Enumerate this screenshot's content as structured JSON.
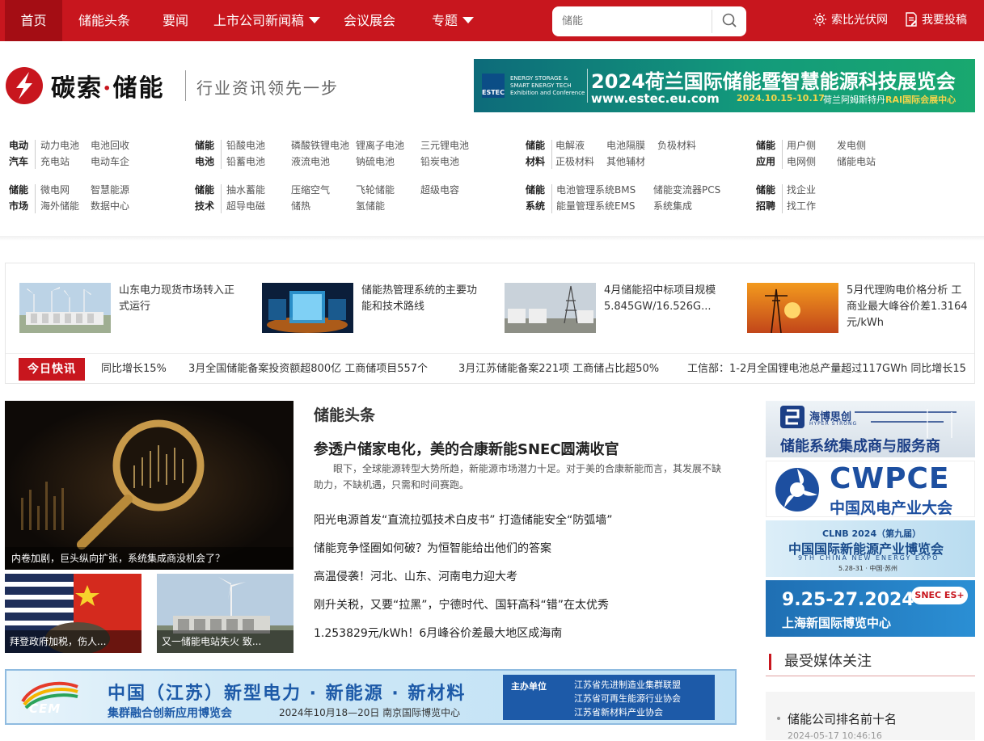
{
  "nav": {
    "home": "首页",
    "items": [
      "储能头条",
      "要闻",
      "上市公司新闻稿",
      "会议展会",
      "专题"
    ],
    "search_placeholder": "储能",
    "link1": "索比光伏网",
    "link2": "我要投稿"
  },
  "brand": {
    "name_part1": "碳索",
    "dot": "·",
    "name_part2": "储能",
    "slogan": "行业资讯领先一步"
  },
  "estec_banner": {
    "logo": "ESTEC",
    "sub": "ENERGY STORAGE & SMART ENERGY TECH",
    "sub2": "Exhibition and Conference",
    "title": "2024荷兰国际储能暨智慧能源科技展览会",
    "url": "www.estec.eu.com",
    "date": "2024.10.15-10.17",
    "venue": "荷兰阿姆斯特丹",
    "venue_hl": "RAI国际会展中心"
  },
  "categories": [
    {
      "l1": "电动",
      "l2": "汽车",
      "links": [
        "动力电池",
        "电池回收",
        "充电站",
        "电动车企"
      ]
    },
    {
      "l1": "储能",
      "l2": "电池",
      "links": [
        "铅酸电池",
        "磷酸铁锂电池",
        "锂离子电池",
        "三元锂电池",
        "铅蓄电池",
        "液流电池",
        "钠硫电池",
        "铅炭电池"
      ]
    },
    {
      "l1": "储能",
      "l2": "材料",
      "links": [
        "电解液",
        "电池隔膜",
        "负极材料",
        "正极材料",
        "其他辅材"
      ]
    },
    {
      "l1": "储能",
      "l2": "应用",
      "links": [
        "用户侧",
        "发电侧",
        "电网侧",
        "储能电站"
      ]
    },
    {
      "l1": "储能",
      "l2": "市场",
      "links": [
        "微电网",
        "智慧能源",
        "海外储能",
        "数据中心"
      ]
    },
    {
      "l1": "储能",
      "l2": "技术",
      "links": [
        "抽水蓄能",
        "压缩空气",
        "飞轮储能",
        "超级电容",
        "超导电磁",
        "储热",
        "氢储能"
      ]
    },
    {
      "l1": "储能",
      "l2": "系统",
      "links": [
        "电池管理系统BMS",
        "储能变流器PCS",
        "能量管理系统EMS",
        "系统集成"
      ]
    },
    {
      "l1": "储能",
      "l2": "招聘",
      "links": [
        "找企业",
        "找工作"
      ]
    }
  ],
  "featured": [
    {
      "title": "山东电力现货市场转入正式运行"
    },
    {
      "title": "储能热管理系统的主要功能和技术路线"
    },
    {
      "title": "4月储能招中标项目规模5.845GW/16.526G..."
    },
    {
      "title": "5月代理购电价格分析 工商业最大峰谷价差1.3164元/kWh"
    }
  ],
  "flash": {
    "tag": "今日快讯",
    "items": [
      "同比增长15%",
      "3月全国储能备案投资额超800亿 工商储项目557个",
      "3月江苏储能备案221项 工商储占比超50%",
      "工信部：1-2月全国锂电池总产量超过117GWh 同比增长15"
    ]
  },
  "main": {
    "image_caption": "内卷加剧，巨头纵向扩张，系统集成商没机会了？",
    "small1_caption": "拜登政府加税，伤人...",
    "small2_caption": "又一储能电站失火 致...",
    "section_title": "储能头条",
    "headline": "参透户储家电化，美的合康新能SNEC圆满收官",
    "summary": "眼下，全球能源转型大势所趋，新能源市场潜力十足。对于美的合康新能而言，其发展不缺助力，不缺机遇，只需和时间赛跑。",
    "news": [
      "阳光电源首发“直流拉弧技术白皮书” 打造储能安全“防弧墙”",
      "储能竞争怪圈如何破？为恒智能给出他们的答案",
      "高温侵袭！河北、山东、河南电力迎大考",
      "刚升关税，又要“拉黑”，宁德时代、国轩高科“错”在太优秀",
      "1.253829元/kWh！6月峰谷价差最大地区成海南"
    ]
  },
  "ads": {
    "hbs_brand": "海博思创",
    "hbs_brand_en": "HYPER STRONG",
    "hbs_text": "储能系统集成商与服务商",
    "cwpce_title": "CWPCE",
    "cwpce_sub": "中国风电产业大会",
    "clnb_title": "CLNB 2024（第九届）",
    "clnb_main": "中国国际新能源产业博览会",
    "clnb_en": "9TH CHINA NEW ENERGY EXPO",
    "clnb_date": "5.28-31 · 中国·苏州",
    "snec_date": "9.25-27.2024",
    "snec_venue": "上海新国际博览中心",
    "snec_logo": "SNEC ES+"
  },
  "media": {
    "heading": "最受媒体关注",
    "item": "储能公司排名前十名",
    "date": "2024-05-17 10:46:16"
  },
  "cem": {
    "logo": "CEM",
    "title": "中国（江苏）新型电力 · 新能源 · 新材料",
    "subtitle": "集群融合创新应用博览会",
    "date": "2024年10月18—20日   南京国际博览中心",
    "host_label": "主办单位",
    "orgs": [
      "江苏省先进制造业集群联盟",
      "江苏省可再生能源行业协会",
      "江苏省新材料产业协会"
    ]
  },
  "colors": {
    "brand_red": "#c8161e",
    "home_dark": "#a40d14"
  }
}
